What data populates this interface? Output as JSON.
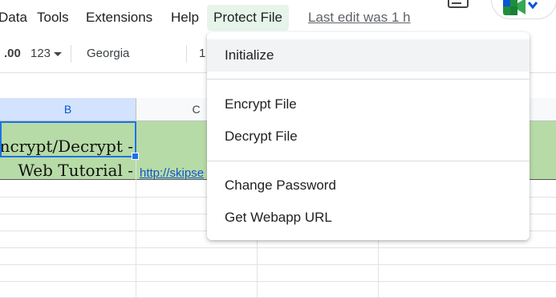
{
  "menubar": {
    "items": [
      "Data",
      "Tools",
      "Extensions",
      "Help",
      "Protect File"
    ],
    "last_edit": "Last edit was 1 h"
  },
  "toolbar": {
    "decimal_increase": ".00",
    "number_format": "123",
    "font": "Georgia",
    "font_size": "1"
  },
  "sheet": {
    "columns": [
      "B",
      "C"
    ],
    "cells": {
      "b_row1": "ncrypt/Decrypt -",
      "b_row2": "Web Tutorial -",
      "c_row2": "http://skipse"
    },
    "accent_fill": "#b7dba6"
  },
  "protect_menu": {
    "items": [
      {
        "label": "Initialize"
      },
      {
        "label": "Encrypt File"
      },
      {
        "label": "Decrypt File"
      },
      {
        "label": "Change Password"
      },
      {
        "label": "Get Webapp URL"
      }
    ]
  },
  "colors": {
    "active_menu_bg": "#e6f4ea",
    "selection": "#1a73e8",
    "link": "#1155cc"
  }
}
